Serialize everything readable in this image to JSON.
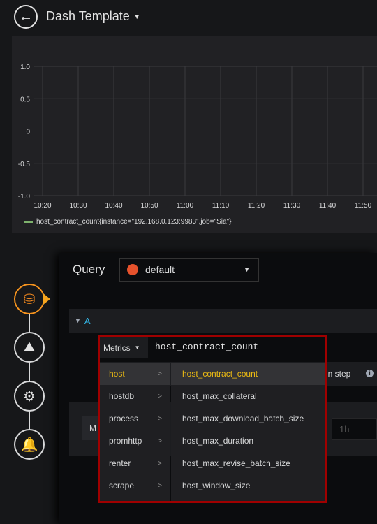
{
  "header": {
    "title": "Dash Template",
    "back_icon": "arrow-left-icon"
  },
  "chart_data": {
    "type": "line",
    "x": [
      "10:20",
      "10:30",
      "10:40",
      "10:50",
      "11:00",
      "11:10",
      "11:20",
      "11:30",
      "11:40",
      "11:50"
    ],
    "yticks": [
      "1.0",
      "0.5",
      "0",
      "-0.5",
      "-1.0"
    ],
    "ylim": [
      -1,
      1
    ],
    "grid": true,
    "legend": "bottom-left",
    "series": [
      {
        "name": "host_contract_count{instance=\"192.168.0.123:9983\",job=\"Sia\"}",
        "values": [
          0,
          0,
          0,
          0,
          0,
          0,
          0,
          0,
          0,
          0
        ],
        "color": "#7eb26d"
      }
    ]
  },
  "query": {
    "label": "Query",
    "datasource": "default",
    "row_letter": "A",
    "metrics_label": "Metrics",
    "input_value": "host_contract_count",
    "min_step_label": "in step",
    "step_placeholder": "1h",
    "partial_label": "M"
  },
  "dropdown": {
    "groups": [
      {
        "label": "host",
        "arrow": ">"
      },
      {
        "label": "hostdb",
        "arrow": ">"
      },
      {
        "label": "process",
        "arrow": ">"
      },
      {
        "label": "promhttp",
        "arrow": ">"
      },
      {
        "label": "renter",
        "arrow": ">"
      },
      {
        "label": "scrape",
        "arrow": ">"
      }
    ],
    "metrics": [
      "host_contract_count",
      "host_max_collateral",
      "host_max_download_batch_size",
      "host_max_duration",
      "host_max_revise_batch_size",
      "host_window_size"
    ]
  },
  "colors": {
    "accent": "#f7941e",
    "selected": "#ecbb13",
    "highlight_border": "#a00000",
    "series": "#7eb26d"
  }
}
